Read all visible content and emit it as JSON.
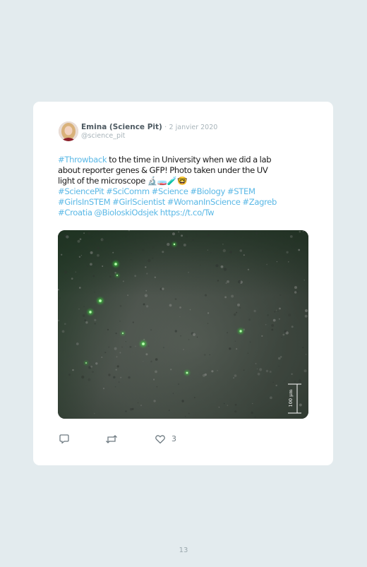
{
  "tweet": {
    "author_name": "Emina (Science Pit)",
    "separator": "·",
    "date": "2 janvier 2020",
    "handle": "@science_pit",
    "lines": [
      [
        {
          "text": "#Throwback",
          "kind": "tag"
        },
        {
          "text": " to the time in University when we did a lab",
          "kind": "plain"
        }
      ],
      [
        {
          "text": "about reporter genes & GFP! Photo taken under the UV",
          "kind": "plain"
        }
      ],
      [
        {
          "text": "light of the microscope 🔬🧫🧪🤓",
          "kind": "plain"
        }
      ],
      [
        {
          "text": "#SciencePit #SciComm #Science #Biology #STEM",
          "kind": "tag"
        }
      ],
      [
        {
          "text": "#GirlsInSTEM #GirlScientist #WomanInScience #Zagreb",
          "kind": "tag"
        }
      ],
      [
        {
          "text": "#Croatia @BioloskiOdsjek https://t.co/Tw",
          "kind": "tag"
        }
      ]
    ],
    "like_count": "3"
  },
  "media": {
    "scale_label": "100 μm",
    "glow_color": "#3cff3c"
  },
  "icons": {
    "reply": "reply-icon",
    "retweet": "retweet-icon",
    "like": "heart-icon"
  },
  "page": {
    "number": "13"
  }
}
